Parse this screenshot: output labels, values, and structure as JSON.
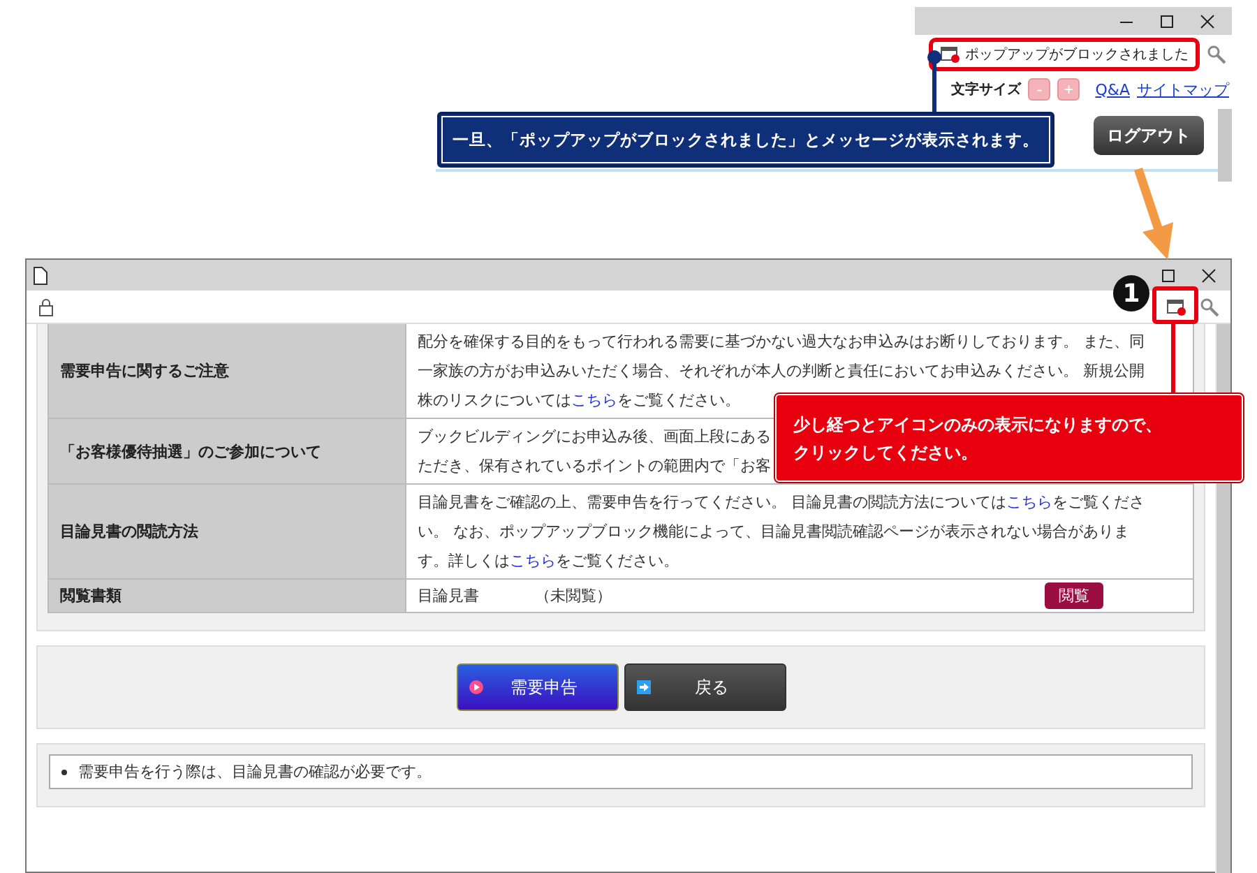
{
  "top_window": {
    "popup_notice": "ポップアップがブロックされました",
    "font_size_label": "文字サイズ",
    "font_size_buttons": [
      "-",
      "+"
    ],
    "links": [
      "Q&A",
      "サイトマップ"
    ],
    "logout_button": "ログアウト"
  },
  "top_callout": "一旦、「ポップアップがブロックされました」とメッセージが表示されます。",
  "step_number": "1",
  "bottom_callout": [
    "少し経つとアイコンのみの表示になりますので、",
    "クリックしてください。"
  ],
  "main_window": {
    "table": {
      "rows": [
        {
          "kind": "text",
          "label": "需要申告に関するご注意",
          "segments": [
            {
              "kind": "plain",
              "text": "配分を確保する目的をもって行われる需要に基づかない過大なお申込みはお断りしております。 また、同一家族の方がお申込みいただく場合、それぞれが本人の判断と責任においてお申込みください。 新規公開株のリスクについては"
            },
            {
              "kind": "link",
              "text": "こちら"
            },
            {
              "kind": "plain",
              "text": "をご覧ください。"
            }
          ]
        },
        {
          "kind": "lines",
          "label": "「お客様優待抽選」のご参加について",
          "lines": [
            "ブックビルディングにお申込み後、画面上段にある",
            "ただき、保有されているポイントの範囲内で「お客"
          ]
        },
        {
          "kind": "text",
          "label": "目論見書の閲読方法",
          "segments": [
            {
              "kind": "plain",
              "text": "目論見書をご確認の上、需要申告を行ってください。 目論見書の閲読方法については"
            },
            {
              "kind": "link",
              "text": "こちら"
            },
            {
              "kind": "plain",
              "text": "をご覧ください。 なお、ポップアップブロック機能によって、目論見書閲読確認ページが表示されない場合があります。詳しくは"
            },
            {
              "kind": "link",
              "text": "こちら"
            },
            {
              "kind": "plain",
              "text": "をご覧ください。"
            }
          ]
        },
        {
          "kind": "document",
          "label": "閲覧書類",
          "document": "目論見書",
          "status": "（未閲覧）",
          "button": "閲覧"
        }
      ]
    },
    "buttons": [
      {
        "label": "需要申告",
        "kind": "primary"
      },
      {
        "label": "戻る",
        "kind": "back"
      }
    ],
    "notes": [
      "需要申告を行う際は、目論見書の確認が必要です。"
    ]
  }
}
